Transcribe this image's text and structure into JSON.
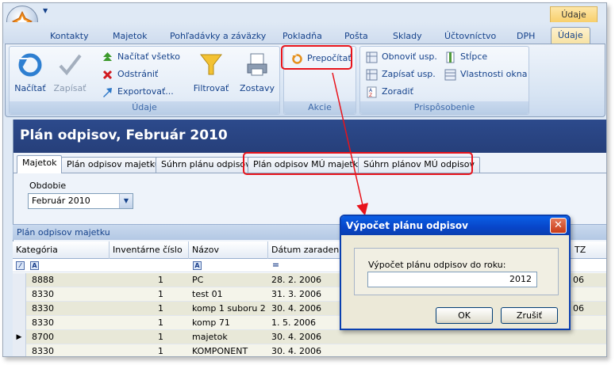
{
  "ribbon": {
    "context_tab_header": "Údaje",
    "tabs": [
      {
        "label": "Kontakty",
        "active": false
      },
      {
        "label": "Majetok",
        "active": false
      },
      {
        "label": "Pohľadávky a záväzky",
        "active": false
      },
      {
        "label": "Pokladňa",
        "active": false
      },
      {
        "label": "Pošta",
        "active": false
      },
      {
        "label": "Sklady",
        "active": false
      },
      {
        "label": "Účtovníctvo",
        "active": false
      },
      {
        "label": "DPH",
        "active": false
      },
      {
        "label": "Údaje",
        "active": true
      }
    ],
    "groups": {
      "udaje": {
        "caption": "Údaje",
        "nacitat": "Načítať",
        "zapisat": "Zapísať",
        "nacitat_vsetko": "Načítať všetko",
        "odstranit": "Odstrániť",
        "exportovat": "Exportovať...",
        "filtrovat": "Filtrovať",
        "zostavy": "Zostavy"
      },
      "akcie": {
        "caption": "Akcie",
        "prepocitat": "Prepočítať"
      },
      "prisposobenie": {
        "caption": "Prispôsobenie",
        "obnovit": "Obnoviť usp.",
        "zapisat_usp": "Zapísať usp.",
        "zoradit": "Zoradiť",
        "stlpce": "Stĺpce",
        "vlastnosti": "Vlastnosti okna"
      }
    }
  },
  "page": {
    "title": "Plán odpisov, Február 2010",
    "tabs": [
      {
        "label": "Majetok",
        "active": true
      },
      {
        "label": "Plán odpisov majetku",
        "active": false
      },
      {
        "label": "Súhrn plánu odpisov",
        "active": false
      },
      {
        "label": "Plán odpisov MÚ majetku",
        "active": false
      },
      {
        "label": "Súhrn plánov MÚ odpisov",
        "active": false
      }
    ],
    "obdobie_label": "Obdobie",
    "obdobie_value": "Február 2010",
    "grid_caption": "Plán odpisov majetku"
  },
  "grid": {
    "columns": [
      "Kategória",
      "Inventárne číslo",
      "Názov",
      "Dátum zaradenia",
      "TZ"
    ],
    "rows": [
      {
        "kategoria": "8888",
        "inv": "1",
        "nazov": "PC",
        "datum": "28. 2. 2006",
        "tz": "06",
        "current": false
      },
      {
        "kategoria": "8330",
        "inv": "1",
        "nazov": "test 01",
        "datum": "31. 3. 2006",
        "tz": "",
        "current": false
      },
      {
        "kategoria": "8330",
        "inv": "1",
        "nazov": "komp 1 suboru 2",
        "datum": "30. 4. 2006",
        "tz": "06",
        "current": false
      },
      {
        "kategoria": "8330",
        "inv": "1",
        "nazov": "komp 71",
        "datum": "1. 5. 2006",
        "tz": "",
        "current": false
      },
      {
        "kategoria": "8700",
        "inv": "1",
        "nazov": "majetok",
        "datum": "30. 4. 2006",
        "tz": "",
        "current": true
      },
      {
        "kategoria": "8330",
        "inv": "1",
        "nazov": "KOMPONENT",
        "datum": "30. 4. 2006",
        "tz": "",
        "current": false
      }
    ]
  },
  "dialog": {
    "title": "Výpočet plánu odpisov",
    "label": "Výpočet plánu odpisov do roku:",
    "value": "2012",
    "ok": "OK",
    "cancel": "Zrušiť",
    "close": "✕"
  },
  "colors": {
    "header_band": "#2c4a8c",
    "highlight": "#e8131b",
    "dialog_title": "#0a5fe6",
    "active_tab": "#f7e2a2"
  }
}
